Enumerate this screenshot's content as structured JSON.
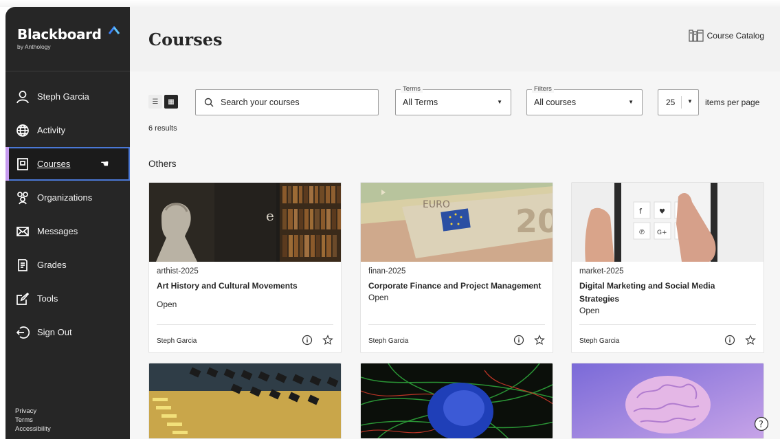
{
  "brand": {
    "name": "Blackboard",
    "sub": "by Anthology"
  },
  "sidebar": {
    "items": [
      {
        "label": "Steph Garcia",
        "icon": "user-icon"
      },
      {
        "label": "Activity",
        "icon": "globe-icon"
      },
      {
        "label": "Courses",
        "icon": "courses-icon",
        "active": true
      },
      {
        "label": "Organizations",
        "icon": "organizations-icon"
      },
      {
        "label": "Messages",
        "icon": "mail-icon"
      },
      {
        "label": "Grades",
        "icon": "grades-icon"
      },
      {
        "label": "Tools",
        "icon": "tools-icon"
      },
      {
        "label": "Sign Out",
        "icon": "sign-out-icon"
      }
    ],
    "footer": [
      "Privacy",
      "Terms",
      "Accessibility"
    ]
  },
  "header": {
    "title": "Courses",
    "catalog_label": "Course Catalog"
  },
  "toolbar": {
    "search_placeholder": "Search your courses",
    "terms_legend": "Terms",
    "terms_value": "All Terms",
    "filters_legend": "Filters",
    "filters_value": "All courses",
    "per_page_value": "25",
    "per_page_label": "items per page"
  },
  "results": "6 results",
  "section": "Others",
  "courses": [
    {
      "code": "arthist-2025",
      "name": "Art History and Cultural Movements",
      "status": "Open",
      "instructor": "Steph Garcia"
    },
    {
      "code": "finan-2025",
      "name": "Corporate Finance and Project Management",
      "status": "Open",
      "instructor": "Steph Garcia"
    },
    {
      "code": "market-2025",
      "name": "Digital Marketing and Social Media Strategies",
      "status": "Open",
      "instructor": "Steph Garcia"
    }
  ],
  "colors": {
    "sidebar": "#262626",
    "accent_purple": "#c69bf0",
    "focus_blue": "#4a78d6",
    "brand_blue": "#3b82f6"
  }
}
